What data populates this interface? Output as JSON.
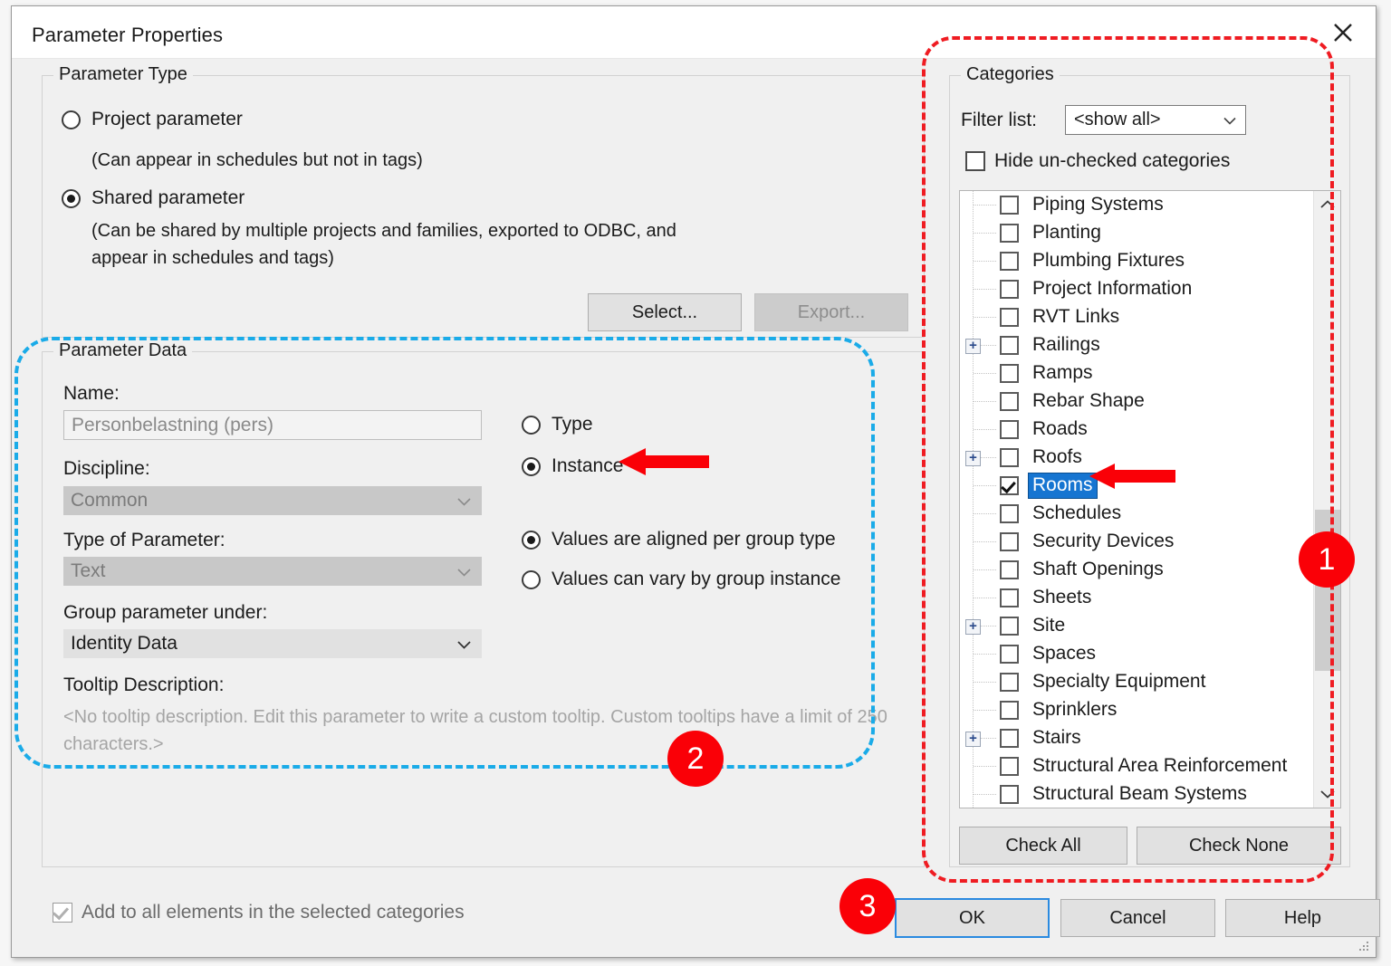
{
  "window": {
    "title": "Parameter Properties",
    "close_icon": "close-icon"
  },
  "parameter_type": {
    "legend": "Parameter Type",
    "options": [
      {
        "label": "Project parameter",
        "checked": false,
        "hint": "(Can appear in schedules but not in tags)"
      },
      {
        "label": "Shared parameter",
        "checked": true,
        "hint": "(Can be shared by multiple projects and families, exported to ODBC, and\nappear in schedules and tags)"
      }
    ],
    "select_button": "Select...",
    "export_button": "Export..."
  },
  "parameter_data": {
    "legend": "Parameter Data",
    "name_label": "Name:",
    "name_value": "Personbelastning (pers)",
    "discipline_label": "Discipline:",
    "discipline_value": "Common",
    "type_label": "Type of Parameter:",
    "type_value": "Text",
    "group_label": "Group parameter under:",
    "group_value": "Identity Data",
    "tooltip_label": "Tooltip Description:",
    "tooltip_value": "<No tooltip description. Edit this parameter to write a custom tooltip. Custom tooltips have a limit of 250 characters.>",
    "binding_options": [
      {
        "label": "Type",
        "checked": false
      },
      {
        "label": "Instance",
        "checked": true
      }
    ],
    "group_value_options": [
      {
        "label": "Values are aligned per group type",
        "checked": true
      },
      {
        "label": "Values can vary by group instance",
        "checked": false
      }
    ]
  },
  "categories": {
    "legend": "Categories",
    "filter_label": "Filter list:",
    "filter_value": "<show all>",
    "hide_unchecked_label": "Hide un-checked categories",
    "hide_unchecked_checked": false,
    "items": [
      {
        "label": "Piping Systems",
        "checked": false,
        "expandable": false,
        "selected": false
      },
      {
        "label": "Planting",
        "checked": false,
        "expandable": false,
        "selected": false
      },
      {
        "label": "Plumbing Fixtures",
        "checked": false,
        "expandable": false,
        "selected": false
      },
      {
        "label": "Project Information",
        "checked": false,
        "expandable": false,
        "selected": false
      },
      {
        "label": "RVT Links",
        "checked": false,
        "expandable": false,
        "selected": false
      },
      {
        "label": "Railings",
        "checked": false,
        "expandable": true,
        "selected": false
      },
      {
        "label": "Ramps",
        "checked": false,
        "expandable": false,
        "selected": false
      },
      {
        "label": "Rebar Shape",
        "checked": false,
        "expandable": false,
        "selected": false
      },
      {
        "label": "Roads",
        "checked": false,
        "expandable": false,
        "selected": false
      },
      {
        "label": "Roofs",
        "checked": false,
        "expandable": true,
        "selected": false
      },
      {
        "label": "Rooms",
        "checked": true,
        "expandable": false,
        "selected": true
      },
      {
        "label": "Schedules",
        "checked": false,
        "expandable": false,
        "selected": false
      },
      {
        "label": "Security Devices",
        "checked": false,
        "expandable": false,
        "selected": false
      },
      {
        "label": "Shaft Openings",
        "checked": false,
        "expandable": false,
        "selected": false
      },
      {
        "label": "Sheets",
        "checked": false,
        "expandable": false,
        "selected": false
      },
      {
        "label": "Site",
        "checked": false,
        "expandable": true,
        "selected": false
      },
      {
        "label": "Spaces",
        "checked": false,
        "expandable": false,
        "selected": false
      },
      {
        "label": "Specialty Equipment",
        "checked": false,
        "expandable": false,
        "selected": false
      },
      {
        "label": "Sprinklers",
        "checked": false,
        "expandable": false,
        "selected": false
      },
      {
        "label": "Stairs",
        "checked": false,
        "expandable": true,
        "selected": false
      },
      {
        "label": "Structural Area Reinforcement",
        "checked": false,
        "expandable": false,
        "selected": false
      },
      {
        "label": "Structural Beam Systems",
        "checked": false,
        "expandable": false,
        "selected": false
      }
    ],
    "expander_glyph": "+",
    "check_all_button": "Check All",
    "check_none_button": "Check None",
    "scroll_up_icon": "chevron-up-icon",
    "scroll_down_icon": "chevron-down-icon"
  },
  "footer": {
    "add_all_label": "Add to all elements in the selected categories",
    "add_all_checked": true,
    "ok_button": "OK",
    "cancel_button": "Cancel",
    "help_button": "Help"
  },
  "annotations": {
    "badges": [
      {
        "number": "1"
      },
      {
        "number": "2"
      },
      {
        "number": "3"
      }
    ],
    "colors": {
      "red": "#ef1c22",
      "cyan": "#1aabe8",
      "badge": "#fa0007",
      "selection_blue": "#1675d1",
      "focus_blue": "#2a8ae0"
    }
  }
}
